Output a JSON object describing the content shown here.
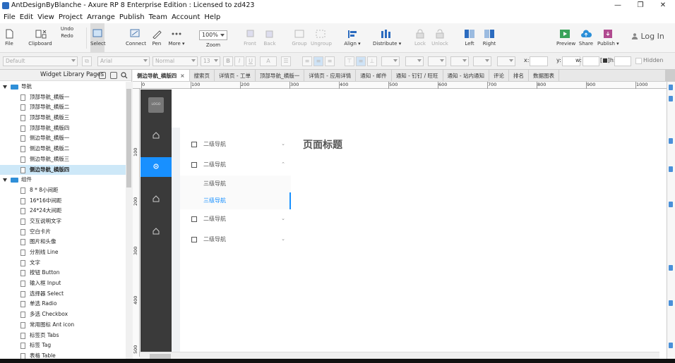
{
  "window": {
    "title": "AntDesignByBlanche - Axure RP 8 Enterprise Edition : Licensed to zd423",
    "minimize": "—",
    "restore": "❐",
    "close": "✕"
  },
  "menu": [
    "File",
    "Edit",
    "View",
    "Project",
    "Arrange",
    "Publish",
    "Team",
    "Account",
    "Help"
  ],
  "toolbar": {
    "file": "File",
    "clipboard": "Clipboard",
    "undo": "Undo",
    "redo": "Redo",
    "select": "Select",
    "connect": "Connect",
    "pen": "Pen",
    "more": "More ▾",
    "zoom_value": "100%",
    "zoom": "Zoom",
    "front": "Front",
    "back": "Back",
    "group": "Group",
    "ungroup": "Ungroup",
    "align": "Align ▾",
    "distribute": "Distribute ▾",
    "lock": "Lock",
    "unlock": "Unlock",
    "left": "Left",
    "right": "Right",
    "preview": "Preview",
    "share": "Share",
    "publish": "Publish ▾",
    "login": "Log In"
  },
  "format": {
    "style": "Default",
    "font": "Arial",
    "weight": "Normal",
    "size": "13",
    "bold": "B",
    "italic": "I",
    "underline": "U",
    "x_label": "x:",
    "y_label": "y:",
    "w_label": "w:",
    "h_label": "h:",
    "hidden_label": "Hidden"
  },
  "library": {
    "title": "Widget Library Pages",
    "nodes": [
      {
        "label": "导航",
        "type": "folder"
      },
      {
        "label": "顶部导航_横版一",
        "type": "page"
      },
      {
        "label": "顶部导航_横版二",
        "type": "page"
      },
      {
        "label": "顶部导航_横版三",
        "type": "page"
      },
      {
        "label": "顶部导航_横版四",
        "type": "page"
      },
      {
        "label": "侧边导航_横版一",
        "type": "page"
      },
      {
        "label": "侧边导航_横版二",
        "type": "page"
      },
      {
        "label": "侧边导航_横版三",
        "type": "page"
      },
      {
        "label": "侧边导航_横版四",
        "type": "page",
        "selected": true
      },
      {
        "label": "组件",
        "type": "folder"
      },
      {
        "label": "8 * 8小间距",
        "type": "page"
      },
      {
        "label": "16*16中间距",
        "type": "page"
      },
      {
        "label": "24*24大间距",
        "type": "page"
      },
      {
        "label": "交互说明文字",
        "type": "page"
      },
      {
        "label": "空白卡片",
        "type": "page"
      },
      {
        "label": "图片和头像",
        "type": "page"
      },
      {
        "label": "分割线 Line",
        "type": "page"
      },
      {
        "label": "文字",
        "type": "page"
      },
      {
        "label": "按钮 Button",
        "type": "page"
      },
      {
        "label": "输入框 Input",
        "type": "page"
      },
      {
        "label": "选择器 Select",
        "type": "page"
      },
      {
        "label": "单选 Radio",
        "type": "page"
      },
      {
        "label": "多选 Checkbox",
        "type": "page"
      },
      {
        "label": "常用图标 Ant icon",
        "type": "page"
      },
      {
        "label": "标签页 Tabs",
        "type": "page"
      },
      {
        "label": "标签 Tag",
        "type": "page"
      },
      {
        "label": "表格 Table",
        "type": "page"
      }
    ]
  },
  "tabs": [
    {
      "label": "侧边导航_横版四",
      "active": true,
      "close": "×"
    },
    {
      "label": "搜索页"
    },
    {
      "label": "详情页 - 工单"
    },
    {
      "label": "顶部导航_横版一"
    },
    {
      "label": "详情页 - 应用详情"
    },
    {
      "label": "通知 - 邮件"
    },
    {
      "label": "通知 - 钉钉 / 旺旺"
    },
    {
      "label": "通知 - 站内通知"
    },
    {
      "label": "评论"
    },
    {
      "label": "排名"
    },
    {
      "label": "数据图表"
    }
  ],
  "ruler": {
    "h": [
      "0",
      "100",
      "200",
      "300",
      "400",
      "500",
      "600",
      "700",
      "800",
      "900",
      "1000"
    ],
    "v": [
      "100",
      "200",
      "300",
      "400",
      "500"
    ]
  },
  "design": {
    "logo": "LOGO",
    "page_title": "页面标题",
    "menu": [
      {
        "label": "二级导航",
        "chev": "⌄"
      },
      {
        "label": "二级导航",
        "chev": "⌃"
      },
      {
        "label": "三级导航",
        "sub": true
      },
      {
        "label": "三级导航",
        "sub": true,
        "active": true
      },
      {
        "label": "二级导航",
        "chev": "⌄"
      },
      {
        "label": "二级导航",
        "chev": "⌄"
      }
    ],
    "accent": "#1890ff",
    "sidebar_bg": "#3a3a3a"
  }
}
